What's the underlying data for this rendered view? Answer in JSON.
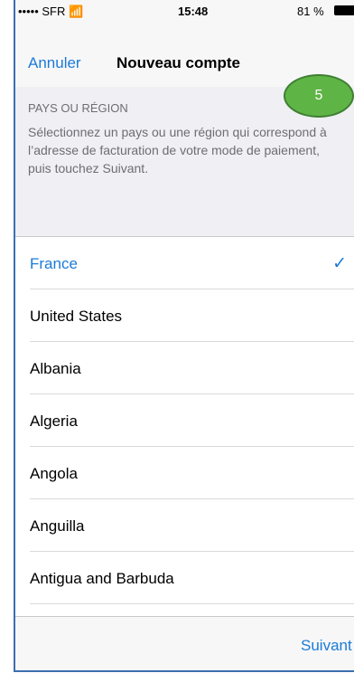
{
  "status": {
    "carrier": "••••• SFR",
    "wifi_icon": "wifi-icon",
    "time": "15:48",
    "battery": "81 %"
  },
  "nav": {
    "cancel": "Annuler",
    "title": "Nouveau compte"
  },
  "badge": "5",
  "section": {
    "title": "PAYS OU RÉGION",
    "description": "Sélectionnez un pays ou une région qui correspond à l’adresse de facturation de votre mode de paiement, puis touchez Suivant."
  },
  "countries": [
    {
      "label": "France",
      "selected": true
    },
    {
      "label": "United States"
    },
    {
      "label": "Albania"
    },
    {
      "label": "Algeria"
    },
    {
      "label": "Angola"
    },
    {
      "label": "Anguilla"
    },
    {
      "label": "Antigua and Barbuda"
    }
  ],
  "check": "✓",
  "toolbar": {
    "next": "Suivant"
  },
  "colors": {
    "accent": "#1a7bd6",
    "badge": "#5fb446"
  }
}
